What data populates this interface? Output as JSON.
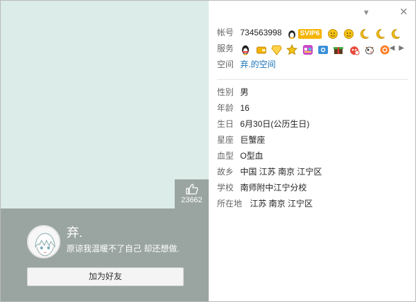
{
  "window": {
    "minimize_label": "▾",
    "close_label": "✕"
  },
  "profile": {
    "nickname": "弃.",
    "signature": "原谅我温暖不了自己  却还想做.",
    "add_friend_label": "加为好友",
    "like_count": "23662"
  },
  "account": {
    "label": "帐号",
    "value": "734563998",
    "vip": "SVIP6"
  },
  "services": {
    "label": "服务"
  },
  "space": {
    "label": "空间",
    "link": "弃.的空间"
  },
  "details": [
    {
      "label": "性别",
      "value": "男"
    },
    {
      "label": "年龄",
      "value": "16"
    },
    {
      "label": "生日",
      "value": "6月30日(公历生日)"
    },
    {
      "label": "星座",
      "value": "巨蟹座"
    },
    {
      "label": "血型",
      "value": "O型血"
    },
    {
      "label": "故乡",
      "value": "中国 江苏 南京 江宁区"
    },
    {
      "label": "学校",
      "value": "南师附中江宁分校"
    },
    {
      "label": "所在地",
      "value": "江苏 南京 江宁区"
    }
  ],
  "colors": {
    "accent": "#1a73b8",
    "card": "#9aa5a2",
    "background": "#dcece8"
  }
}
